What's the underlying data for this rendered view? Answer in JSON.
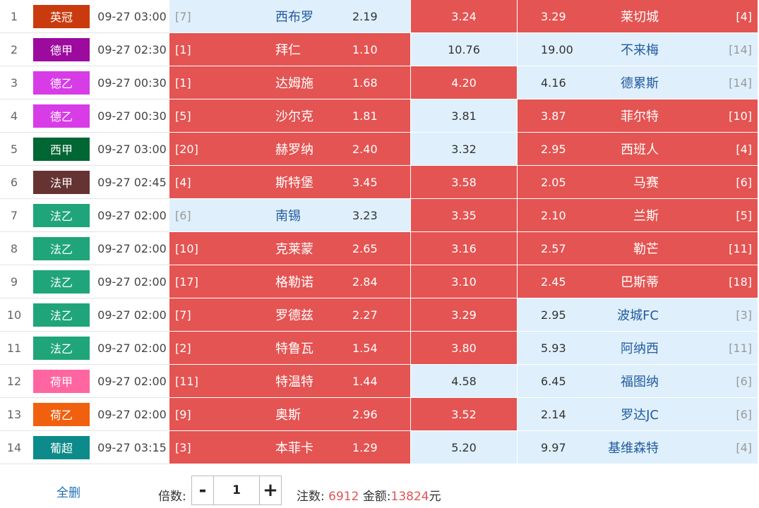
{
  "colors": {
    "selected_bg": "#e35452",
    "unselected_bg": "#dff0fc",
    "team_link": "#235a9e",
    "action_link": "#1e6fb8"
  },
  "matches": [
    {
      "index": "1",
      "league": "英冠",
      "league_color": "#c93b0e",
      "time": "09-27 03:00",
      "home_rank": "[7]",
      "home": "西布罗",
      "home_odd": "2.19",
      "home_sel": false,
      "draw_odd": "3.24",
      "draw_sel": true,
      "away_odd": "3.29",
      "away": "莱切城",
      "away_rank": "[4]",
      "away_sel": true
    },
    {
      "index": "2",
      "league": "德甲",
      "league_color": "#9c0a9e",
      "time": "09-27 02:30",
      "home_rank": "[1]",
      "home": "拜仁",
      "home_odd": "1.10",
      "home_sel": true,
      "draw_odd": "10.76",
      "draw_sel": false,
      "away_odd": "19.00",
      "away": "不来梅",
      "away_rank": "[14]",
      "away_sel": false
    },
    {
      "index": "3",
      "league": "德乙",
      "league_color": "#d73ce6",
      "time": "09-27 00:30",
      "home_rank": "[1]",
      "home": "达姆施",
      "home_odd": "1.68",
      "home_sel": true,
      "draw_odd": "4.20",
      "draw_sel": true,
      "away_odd": "4.16",
      "away": "德累斯",
      "away_rank": "[14]",
      "away_sel": false
    },
    {
      "index": "4",
      "league": "德乙",
      "league_color": "#d73ce6",
      "time": "09-27 00:30",
      "home_rank": "[5]",
      "home": "沙尔克",
      "home_odd": "1.81",
      "home_sel": true,
      "draw_odd": "3.81",
      "draw_sel": false,
      "away_odd": "3.87",
      "away": "菲尔特",
      "away_rank": "[10]",
      "away_sel": true
    },
    {
      "index": "5",
      "league": "西甲",
      "league_color": "#006633",
      "time": "09-27 03:00",
      "home_rank": "[20]",
      "home": "赫罗纳",
      "home_odd": "2.40",
      "home_sel": true,
      "draw_odd": "3.32",
      "draw_sel": false,
      "away_odd": "2.95",
      "away": "西班人",
      "away_rank": "[4]",
      "away_sel": true
    },
    {
      "index": "6",
      "league": "法甲",
      "league_color": "#663333",
      "time": "09-27 02:45",
      "home_rank": "[4]",
      "home": "斯特堡",
      "home_odd": "3.45",
      "home_sel": true,
      "draw_odd": "3.58",
      "draw_sel": true,
      "away_odd": "2.05",
      "away": "马赛",
      "away_rank": "[6]",
      "away_sel": true
    },
    {
      "index": "7",
      "league": "法乙",
      "league_color": "#1fa579",
      "time": "09-27 02:00",
      "home_rank": "[6]",
      "home": "南锡",
      "home_odd": "3.23",
      "home_sel": false,
      "draw_odd": "3.35",
      "draw_sel": true,
      "away_odd": "2.10",
      "away": "兰斯",
      "away_rank": "[5]",
      "away_sel": true
    },
    {
      "index": "8",
      "league": "法乙",
      "league_color": "#1fa579",
      "time": "09-27 02:00",
      "home_rank": "[10]",
      "home": "克莱蒙",
      "home_odd": "2.65",
      "home_sel": true,
      "draw_odd": "3.16",
      "draw_sel": true,
      "away_odd": "2.57",
      "away": "勒芒",
      "away_rank": "[11]",
      "away_sel": true
    },
    {
      "index": "9",
      "league": "法乙",
      "league_color": "#1fa579",
      "time": "09-27 02:00",
      "home_rank": "[17]",
      "home": "格勒诺",
      "home_odd": "2.84",
      "home_sel": true,
      "draw_odd": "3.10",
      "draw_sel": true,
      "away_odd": "2.45",
      "away": "巴斯蒂",
      "away_rank": "[18]",
      "away_sel": true
    },
    {
      "index": "10",
      "league": "法乙",
      "league_color": "#1fa579",
      "time": "09-27 02:00",
      "home_rank": "[7]",
      "home": "罗德兹",
      "home_odd": "2.27",
      "home_sel": true,
      "draw_odd": "3.29",
      "draw_sel": true,
      "away_odd": "2.95",
      "away": "波城FC",
      "away_rank": "[3]",
      "away_sel": false
    },
    {
      "index": "11",
      "league": "法乙",
      "league_color": "#1fa579",
      "time": "09-27 02:00",
      "home_rank": "[2]",
      "home": "特鲁瓦",
      "home_odd": "1.54",
      "home_sel": true,
      "draw_odd": "3.80",
      "draw_sel": true,
      "away_odd": "5.93",
      "away": "阿纳西",
      "away_rank": "[11]",
      "away_sel": false
    },
    {
      "index": "12",
      "league": "荷甲",
      "league_color": "#ff66a1",
      "time": "09-27 02:00",
      "home_rank": "[11]",
      "home": "特温特",
      "home_odd": "1.44",
      "home_sel": true,
      "draw_odd": "4.58",
      "draw_sel": false,
      "away_odd": "6.45",
      "away": "福图纳",
      "away_rank": "[6]",
      "away_sel": false
    },
    {
      "index": "13",
      "league": "荷乙",
      "league_color": "#f0600f",
      "time": "09-27 02:00",
      "home_rank": "[9]",
      "home": "奥斯",
      "home_odd": "2.96",
      "home_sel": true,
      "draw_odd": "3.52",
      "draw_sel": true,
      "away_odd": "2.14",
      "away": "罗达JC",
      "away_rank": "[6]",
      "away_sel": false
    },
    {
      "index": "14",
      "league": "葡超",
      "league_color": "#0d8a8a",
      "time": "09-27 03:15",
      "home_rank": "[3]",
      "home": "本菲卡",
      "home_odd": "1.29",
      "home_sel": true,
      "draw_odd": "5.20",
      "draw_sel": false,
      "away_odd": "9.97",
      "away": "基维森特",
      "away_rank": "[4]",
      "away_sel": false
    }
  ],
  "footer": {
    "clear_label": "全删",
    "multiplier_label": "倍数:",
    "minus": "-",
    "multiplier_value": "1",
    "plus": "+",
    "bets_label": "注数:",
    "bets_value": "6912",
    "amount_label": "金额:",
    "amount_value": "13824",
    "currency": "元"
  }
}
